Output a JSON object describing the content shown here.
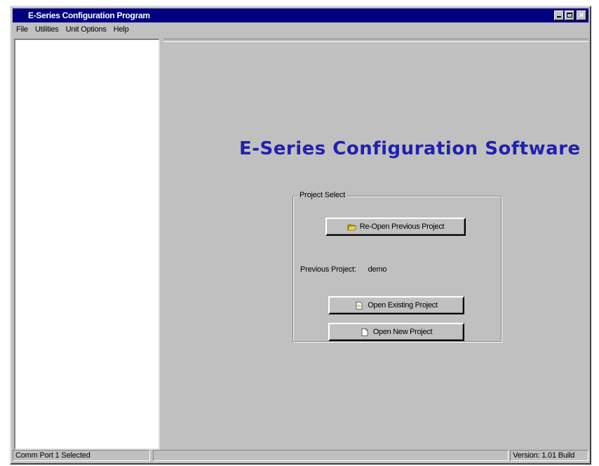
{
  "window": {
    "title": "E-Series Configuration Program"
  },
  "menu": {
    "items": [
      "File",
      "Utilities",
      "Unit Options",
      "Help"
    ]
  },
  "main": {
    "heading": "E-Series Configuration Software",
    "project_select": {
      "legend": "Project Select",
      "reopen_label": "Re-Open Previous Project",
      "previous_project_label": "Previous Project:",
      "previous_project_value": "demo",
      "open_existing_label": "Open Existing Project",
      "open_new_label": "Open New Project"
    }
  },
  "status": {
    "left": "Comm Port 1 Selected",
    "middle": "",
    "right": "Version: 1.01 Build"
  },
  "colors": {
    "titlebar": "#000080",
    "heading": "#2121b0",
    "face": "#c0c0c0"
  }
}
